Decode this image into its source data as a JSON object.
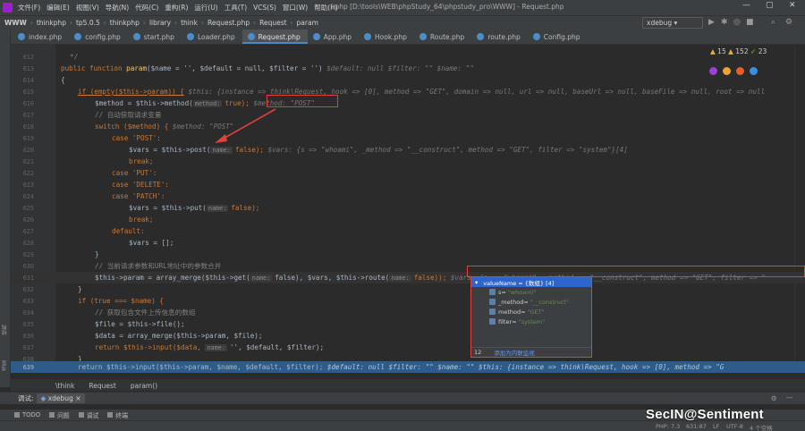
{
  "menubar": {
    "items": [
      "文件(F)",
      "编辑(E)",
      "视图(V)",
      "导航(N)",
      "代码(C)",
      "重构(R)",
      "运行(U)",
      "工具(T)",
      "VCS(S)",
      "窗口(W)",
      "帮助(H)"
    ],
    "title": "l.php [D:\\tools\\WEB\\phpStudy_64\\phpstudy_pro\\WWW] - Request.php",
    "win_min": "—",
    "win_max": "▢",
    "win_close": "✕"
  },
  "navbar": {
    "crumbs": [
      "WWW",
      "thinkphp",
      "tp5.0.5",
      "thinkphp",
      "library",
      "think",
      "Request.php",
      "Request",
      "param"
    ],
    "runconfig": "xdebug"
  },
  "tabs": [
    "index.php",
    "config.php",
    "start.php",
    "Loader.php",
    "Request.php",
    "App.php",
    "Hook.php",
    "Route.php",
    "route.php",
    "Config.php"
  ],
  "inspections": {
    "warnings": "15",
    "weak": "152",
    "ok": "23"
  },
  "code": {
    "l612": "612",
    "l613": "613",
    "l614": "614",
    "l615": "615",
    "l616": "616",
    "l617": "617",
    "l618": "618",
    "l619": "619",
    "l620": "620",
    "l621": "621",
    "l622": "622",
    "l623": "623",
    "l624": "624",
    "l625": "625",
    "l626": "626",
    "l627": "627",
    "l628": "628",
    "l629": "629",
    "l630": "630",
    "l631": "631",
    "l632": "632",
    "l633": "633",
    "l634": "634",
    "l635": "635",
    "l636": "636",
    "l637": "637",
    "l638": "638",
    "l639": "639",
    "c_close": "*/",
    "f_kw": "public function",
    "f_name": "param",
    "f_args": "($name = '', $default = null, $filter = '')",
    "f_hint": "$default: null    $filter: \"\"    $name: \"\"",
    "if_empty": "if (empty($this->param)) {",
    "if_hint": "$this: {instance => think\\Request, hook => [0], method => \"GET\", domain => null, url => null, baseUrl => null, baseFile => null, root => null",
    "method_line": "$method = $this->method(",
    "method_pill": "method:",
    "method_end": "true);",
    "method_hint": "$method: \"POST\"",
    "cmt_auto": "// 自动获取请求变量",
    "switch_line": "switch ($method) {",
    "switch_hint": "$method: \"POST\"",
    "case_post": "case 'POST':",
    "vars_post": "$vars = $this->post(",
    "pill_name": "name:",
    "false_end": "false);",
    "vars_post_hint": "$vars: {s => \"whoami\", _method => \"__construct\", method => \"GET\", filter => \"system\"}[4]",
    "break": "break;",
    "case_put": "case 'PUT':",
    "case_delete": "case 'DELETE':",
    "case_patch": "case 'PATCH':",
    "vars_put": "$vars = $this->put(",
    "default": "default:",
    "vars_empty": "$vars = [];",
    "rbrace": "}",
    "cmt_merge": "// 当前请求参数和URL地址中的参数合并",
    "merge_a": "$this->param = array_merge($this->get(",
    "merge_b": "false), $vars, $this->route(",
    "merge_c": "false));",
    "merge_hint": "$vars: {s => \"whoami\", _method => \"__construct\", method => \"GET\", filter => \"",
    "if_true": "if (true === $name) {",
    "cmt_file": "// 获取包含文件上传信息的数组",
    "file_line": "$file = $this->file();",
    "data_line": "$data = array_merge($this->param, $file);",
    "ret_input": "return $this->input($data,",
    "ret_input_b": "'', $default, $filter);",
    "ret_hl": "return $this->input($this->param, $name, $default, $filter);",
    "ret_hl_hint": "$default: null    $filter: \"\"    $name: \"\"    $this: {instance => think\\Request, hook => [0], method => \"G"
  },
  "popup": {
    "header": "valueName = {数组} [4]",
    "items": [
      {
        "k": "s",
        "v": "\"whoami\""
      },
      {
        "k": "_method",
        "v": "\"__construct\""
      },
      {
        "k": "method",
        "v": "\"GET\""
      },
      {
        "k": "filter",
        "v": "\"system\""
      }
    ],
    "footer_num": "12",
    "footer_link": "添加为内联监视"
  },
  "editor_breadcrumb": [
    "\\think",
    "Request",
    "param()"
  ],
  "debug": {
    "label": "调试:",
    "tab": "xdebug",
    "gear": "⚙",
    "min": "—"
  },
  "bottom_tabs": [
    "TODO",
    "问题",
    "调试",
    "终端"
  ],
  "statusbar": {
    "php": "PHP: 7.3",
    "pos": "631:87",
    "lf": "LF",
    "enc": "UTF-8",
    "indent": "4 个空格"
  },
  "side_labels": [
    "结构",
    "书签"
  ],
  "watermark": "SecIN@Sentiment",
  "colors": {
    "accent": "#2f65ca",
    "highlight": "#2d5b8a",
    "annotation": "#e0423a"
  }
}
